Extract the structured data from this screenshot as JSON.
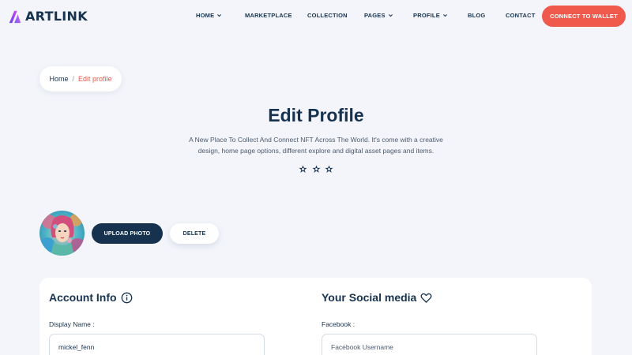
{
  "brand": {
    "name": "ARTLINK",
    "accent": "#ef5a4c",
    "primary": "#16324f"
  },
  "nav": {
    "items": [
      {
        "label": "HOME",
        "has_dropdown": true
      },
      {
        "label": "MARKETPLACE",
        "has_dropdown": false
      },
      {
        "label": "COLLECTION",
        "has_dropdown": false
      },
      {
        "label": "PAGES",
        "has_dropdown": true
      },
      {
        "label": "PROFILE",
        "has_dropdown": true
      },
      {
        "label": "BLOG",
        "has_dropdown": false
      },
      {
        "label": "CONTACT",
        "has_dropdown": false
      }
    ],
    "cta_label": "CONNECT TO WALLET"
  },
  "breadcrumb": {
    "home": "Home",
    "separator": "/",
    "current": "Edit profile"
  },
  "hero": {
    "title": "Edit Profile",
    "subtitle_line1": "A New Place To Collect And Connect NFT Across The World. It's come with a creative",
    "subtitle_line2": "design, home page options, different explore and digital asset pages and items.",
    "decor_icon": "sparkle-icon"
  },
  "photo": {
    "upload_label": "UPLOAD PHOTO",
    "delete_label": "DELETE"
  },
  "account": {
    "title": "Account Info",
    "title_icon": "info-icon",
    "display_name_label": "Display Name :",
    "display_name_value": "mickel_fenn"
  },
  "social": {
    "title": "Your Social media",
    "title_icon": "heart-icon",
    "facebook_label": "Facebook :",
    "facebook_placeholder": "Facebook Username"
  }
}
